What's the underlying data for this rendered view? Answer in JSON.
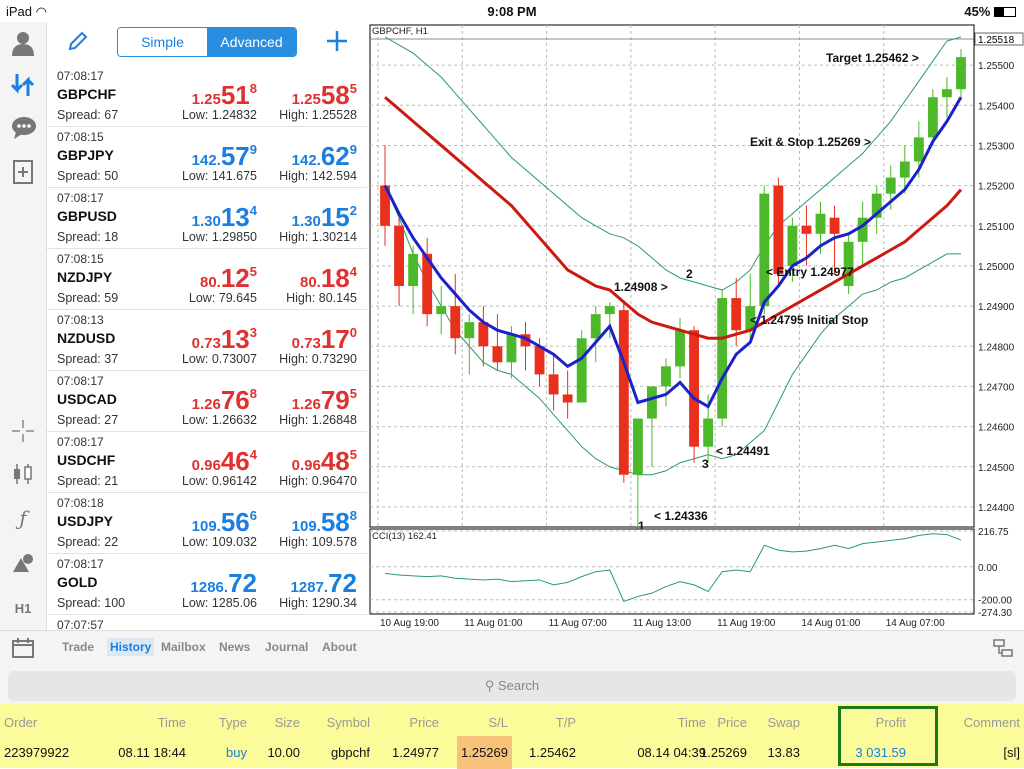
{
  "status": {
    "device": "iPad",
    "time": "9:08 PM",
    "battery": "45%"
  },
  "toolbar": {
    "simple": "Simple",
    "advanced": "Advanced"
  },
  "quotes": [
    {
      "time": "07:08:17",
      "symbol": "GBPCHF",
      "spread": "Spread: 67",
      "bid_pre": "1.25",
      "bid_big": "51",
      "bid_sup": "8",
      "ask_pre": "1.25",
      "ask_big": "58",
      "ask_sup": "5",
      "low": "Low: 1.24832",
      "high": "High: 1.25528",
      "color": "#e03030"
    },
    {
      "time": "07:08:15",
      "symbol": "GBPJPY",
      "spread": "Spread: 50",
      "bid_pre": "142.",
      "bid_big": "57",
      "bid_sup": "9",
      "ask_pre": "142.",
      "ask_big": "62",
      "ask_sup": "9",
      "low": "Low: 141.675",
      "high": "High: 142.594",
      "color": "#1a7fe0"
    },
    {
      "time": "07:08:17",
      "symbol": "GBPUSD",
      "spread": "Spread: 18",
      "bid_pre": "1.30",
      "bid_big": "13",
      "bid_sup": "4",
      "ask_pre": "1.30",
      "ask_big": "15",
      "ask_sup": "2",
      "low": "Low: 1.29850",
      "high": "High: 1.30214",
      "color": "#1a7fe0"
    },
    {
      "time": "07:08:15",
      "symbol": "NZDJPY",
      "spread": "Spread: 59",
      "bid_pre": "80.",
      "bid_big": "12",
      "bid_sup": "5",
      "ask_pre": "80.",
      "ask_big": "18",
      "ask_sup": "4",
      "low": "Low: 79.645",
      "high": "High: 80.145",
      "color": "#e03030"
    },
    {
      "time": "07:08:13",
      "symbol": "NZDUSD",
      "spread": "Spread: 37",
      "bid_pre": "0.73",
      "bid_big": "13",
      "bid_sup": "3",
      "ask_pre": "0.73",
      "ask_big": "17",
      "ask_sup": "0",
      "low": "Low: 0.73007",
      "high": "High: 0.73290",
      "color": "#e03030"
    },
    {
      "time": "07:08:17",
      "symbol": "USDCAD",
      "spread": "Spread: 27",
      "bid_pre": "1.26",
      "bid_big": "76",
      "bid_sup": "8",
      "ask_pre": "1.26",
      "ask_big": "79",
      "ask_sup": "5",
      "low": "Low: 1.26632",
      "high": "High: 1.26848",
      "color": "#e03030"
    },
    {
      "time": "07:08:17",
      "symbol": "USDCHF",
      "spread": "Spread: 21",
      "bid_pre": "0.96",
      "bid_big": "46",
      "bid_sup": "4",
      "ask_pre": "0.96",
      "ask_big": "48",
      "ask_sup": "5",
      "low": "Low: 0.96142",
      "high": "High: 0.96470",
      "color": "#e03030"
    },
    {
      "time": "07:08:18",
      "symbol": "USDJPY",
      "spread": "Spread: 22",
      "bid_pre": "109.",
      "bid_big": "56",
      "bid_sup": "6",
      "ask_pre": "109.",
      "ask_big": "58",
      "ask_sup": "8",
      "low": "Low: 109.032",
      "high": "High: 109.578",
      "color": "#1a7fe0"
    },
    {
      "time": "07:08:17",
      "symbol": "GOLD",
      "spread": "Spread: 100",
      "bid_pre": "1286.",
      "bid_big": "72",
      "bid_sup": "",
      "ask_pre": "1287.",
      "ask_big": "72",
      "ask_sup": "",
      "low": "Low: 1285.06",
      "high": "High: 1290.34",
      "color": "#1a7fe0"
    },
    {
      "time": "07:07:57",
      "symbol": "",
      "spread": "",
      "bid_pre": "",
      "bid_big": "",
      "bid_sup": "",
      "ask_pre": "",
      "ask_big": "",
      "ask_sup": "",
      "low": "",
      "high": "",
      "color": "#1a7fe0"
    }
  ],
  "sidebar_icons": [
    "account-icon",
    "quotes-icon",
    "chat-icon",
    "new-document-icon",
    "crosshair-icon",
    "indicators-icon",
    "function-icon",
    "objects-icon",
    "timeframe-icon"
  ],
  "timeframe_label": "H1",
  "chart": {
    "title": "GBPCHF, H1",
    "indicator": "CCI(13) 162.41",
    "price_ticks": [
      "1.25500",
      "1.25400",
      "1.25300",
      "1.25200",
      "1.25100",
      "1.25000",
      "1.24900",
      "1.24800",
      "1.24700",
      "1.24600",
      "1.24500",
      "1.24400"
    ],
    "current_price": "1.25518",
    "cci_ticks": [
      "216.75",
      "0.00",
      "-200.00",
      "-274.30"
    ],
    "time_ticks": [
      "10 Aug 19:00",
      "11 Aug 01:00",
      "11 Aug 07:00",
      "11 Aug 13:00",
      "11 Aug 19:00",
      "14 Aug 01:00",
      "14 Aug 07:00"
    ],
    "annotations": [
      "Target 1.25462 >",
      "Exit & Stop 1.25269 >",
      "< Entry 1.24977",
      "< 1.24795 Initial Stop",
      "1.24908 >",
      "2",
      "< 1.24491",
      "3",
      "< 1.24336",
      "1"
    ],
    "colors": {
      "up": "#4cb82a",
      "down": "#e8301c",
      "ma_slow": "#cc1a10",
      "ma_fast": "#1a22c8",
      "band": "#2a9a68"
    }
  },
  "chart_data": {
    "type": "candlestick",
    "title": "GBPCHF, H1",
    "ylim": [
      1.2435,
      1.2557
    ],
    "candles": [
      [
        1.252,
        1.253,
        1.2505,
        1.251
      ],
      [
        1.251,
        1.2512,
        1.249,
        1.2495
      ],
      [
        1.2495,
        1.2505,
        1.2488,
        1.2503
      ],
      [
        1.2503,
        1.2507,
        1.2485,
        1.2488
      ],
      [
        1.2488,
        1.2495,
        1.2483,
        1.249
      ],
      [
        1.249,
        1.2498,
        1.2478,
        1.2482
      ],
      [
        1.2482,
        1.2488,
        1.2473,
        1.2486
      ],
      [
        1.2486,
        1.249,
        1.2475,
        1.248
      ],
      [
        1.248,
        1.2488,
        1.2474,
        1.2476
      ],
      [
        1.2476,
        1.2485,
        1.2472,
        1.2483
      ],
      [
        1.2483,
        1.2486,
        1.2474,
        1.248
      ],
      [
        1.248,
        1.2482,
        1.247,
        1.2473
      ],
      [
        1.2473,
        1.2478,
        1.2464,
        1.2468
      ],
      [
        1.2468,
        1.2474,
        1.2462,
        1.2466
      ],
      [
        1.2466,
        1.2484,
        1.2466,
        1.2482
      ],
      [
        1.2482,
        1.249,
        1.2476,
        1.2488
      ],
      [
        1.2488,
        1.2491,
        1.2482,
        1.249
      ],
      [
        1.2489,
        1.2491,
        1.2446,
        1.2448
      ],
      [
        1.2448,
        1.2455,
        1.2434,
        1.2462
      ],
      [
        1.2462,
        1.2468,
        1.245,
        1.247
      ],
      [
        1.247,
        1.2477,
        1.2465,
        1.2475
      ],
      [
        1.2475,
        1.2487,
        1.2472,
        1.2484
      ],
      [
        1.2484,
        1.2485,
        1.2451,
        1.2455
      ],
      [
        1.2455,
        1.2468,
        1.2451,
        1.2462
      ],
      [
        1.2462,
        1.2494,
        1.246,
        1.2492
      ],
      [
        1.2492,
        1.2497,
        1.248,
        1.2484
      ],
      [
        1.2484,
        1.2498,
        1.2481,
        1.249
      ],
      [
        1.249,
        1.252,
        1.2488,
        1.2518
      ],
      [
        1.252,
        1.2522,
        1.2495,
        1.2498
      ],
      [
        1.25,
        1.2512,
        1.2496,
        1.251
      ],
      [
        1.251,
        1.2515,
        1.25,
        1.2508
      ],
      [
        1.2508,
        1.2516,
        1.2503,
        1.2513
      ],
      [
        1.2512,
        1.2515,
        1.2498,
        1.2508
      ],
      [
        1.2495,
        1.2508,
        1.2493,
        1.2506
      ],
      [
        1.2506,
        1.2516,
        1.25,
        1.2512
      ],
      [
        1.2512,
        1.252,
        1.2508,
        1.2518
      ],
      [
        1.2518,
        1.2525,
        1.2514,
        1.2522
      ],
      [
        1.2522,
        1.253,
        1.2518,
        1.2526
      ],
      [
        1.2526,
        1.2536,
        1.2522,
        1.2532
      ],
      [
        1.2532,
        1.2544,
        1.253,
        1.2542
      ],
      [
        1.2542,
        1.2547,
        1.2537,
        1.2544
      ],
      [
        1.2544,
        1.2554,
        1.2542,
        1.2552
      ]
    ],
    "ma_fast": [
      1.252,
      1.2513,
      1.2507,
      1.2502,
      1.2497,
      1.2493,
      1.2489,
      1.2486,
      1.2484,
      1.2483,
      1.2482,
      1.248,
      1.2478,
      1.2475,
      1.2477,
      1.2481,
      1.2485,
      1.2476,
      1.2466,
      1.2467,
      1.2468,
      1.2471,
      1.2467,
      1.2465,
      1.2472,
      1.2478,
      1.2481,
      1.2491,
      1.2495,
      1.25,
      1.2502,
      1.2505,
      1.2507,
      1.2508,
      1.251,
      1.2513,
      1.2516,
      1.2519,
      1.2524,
      1.2531,
      1.2536,
      1.2542
    ],
    "ma_slow": [
      1.2542,
      1.2539,
      1.2536,
      1.2533,
      1.253,
      1.2527,
      1.2524,
      1.2521,
      1.2518,
      1.2515,
      1.2511,
      1.2507,
      1.2503,
      1.2499,
      1.2497,
      1.2495,
      1.2494,
      1.2491,
      1.2488,
      1.2486,
      1.2485,
      1.2484,
      1.2483,
      1.2482,
      1.2482,
      1.2483,
      1.2484,
      1.2486,
      1.2488,
      1.249,
      1.2492,
      1.2494,
      1.2496,
      1.2498,
      1.25,
      1.2502,
      1.2504,
      1.2506,
      1.2509,
      1.2512,
      1.2515,
      1.2519
    ],
    "band_upper": [
      1.2557,
      1.2555,
      1.2553,
      1.255,
      1.2547,
      1.2543,
      1.2539,
      1.2535,
      1.2531,
      1.2527,
      1.2524,
      1.2521,
      1.2518,
      1.2515,
      1.2512,
      1.251,
      1.2508,
      1.2507,
      1.2505,
      1.2502,
      1.2499,
      1.2497,
      1.2496,
      1.2495,
      1.2494,
      1.2496,
      1.2499,
      1.2505,
      1.251,
      1.2513,
      1.2516,
      1.2519,
      1.2522,
      1.2525,
      1.2528,
      1.2532,
      1.2536,
      1.2541,
      1.2546,
      1.2551,
      1.2556,
      1.2557
    ],
    "band_lower": [
      1.252,
      1.2512,
      1.2503,
      1.2496,
      1.249,
      1.2484,
      1.248,
      1.2476,
      1.2474,
      1.2473,
      1.247,
      1.2467,
      1.2463,
      1.2459,
      1.2455,
      1.2452,
      1.245,
      1.2449,
      1.2448,
      1.2448,
      1.2449,
      1.2451,
      1.2452,
      1.2453,
      1.2452,
      1.2453,
      1.2456,
      1.2459,
      1.2466,
      1.2473,
      1.2478,
      1.2483,
      1.2487,
      1.249,
      1.2493,
      1.2494,
      1.2496,
      1.2497,
      1.2499,
      1.2501,
      1.2503,
      1.2503
    ],
    "cci": [
      -40,
      -50,
      -55,
      -60,
      -55,
      -70,
      -75,
      -80,
      -75,
      -90,
      -85,
      -80,
      -110,
      -95,
      -60,
      -30,
      -20,
      -210,
      -180,
      -160,
      -120,
      -90,
      -110,
      -150,
      -30,
      -20,
      -30,
      130,
      100,
      90,
      95,
      110,
      130,
      110,
      140,
      150,
      160,
      170,
      190,
      200,
      195,
      162
    ]
  },
  "tabs": [
    "Trade",
    "History",
    "Mailbox",
    "News",
    "Journal",
    "About"
  ],
  "active_tab": "History",
  "search": {
    "placeholder": "Search"
  },
  "orders": {
    "headers": [
      "Order",
      "Time",
      "Type",
      "Size",
      "Symbol",
      "Price",
      "S/L",
      "T/P",
      "Time",
      "Price",
      "Swap",
      "Profit",
      "Comment"
    ],
    "row": [
      "223979922",
      "08.11 18:44",
      "buy",
      "10.00",
      "gbpchf",
      "1.24977",
      "1.25269",
      "1.25462",
      "08.14 04:39",
      "1.25269",
      "13.83",
      "3 031.59",
      "[sl]"
    ]
  }
}
